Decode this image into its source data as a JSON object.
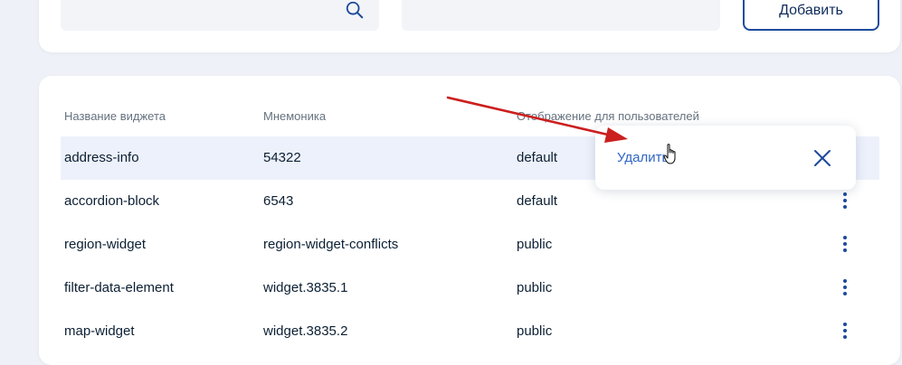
{
  "toolbar": {
    "add_label": "Добавить"
  },
  "table": {
    "headers": [
      "Название виджета",
      "Мнемоника",
      "Отображение для пользователей"
    ],
    "rows": [
      {
        "name": "address-info",
        "mnemonic": "54322",
        "display": "default"
      },
      {
        "name": "accordion-block",
        "mnemonic": "6543",
        "display": "default"
      },
      {
        "name": "region-widget",
        "mnemonic": "region-widget-conflicts",
        "display": "public"
      },
      {
        "name": "filter-data-element",
        "mnemonic": "widget.3835.1",
        "display": "public"
      },
      {
        "name": "map-widget",
        "mnemonic": "widget.3835.2",
        "display": "public"
      }
    ]
  },
  "popover": {
    "delete_label": "Удалить"
  },
  "icons": {
    "search": "search-icon",
    "close": "close-icon",
    "kebab": "more-vertical-icon",
    "cursor": "hand-pointer-icon"
  },
  "colors": {
    "accent": "#1d4a9a",
    "link": "#2f65c6",
    "annotation_arrow": "#cc1f1f",
    "row_highlight": "#edf1fb"
  }
}
